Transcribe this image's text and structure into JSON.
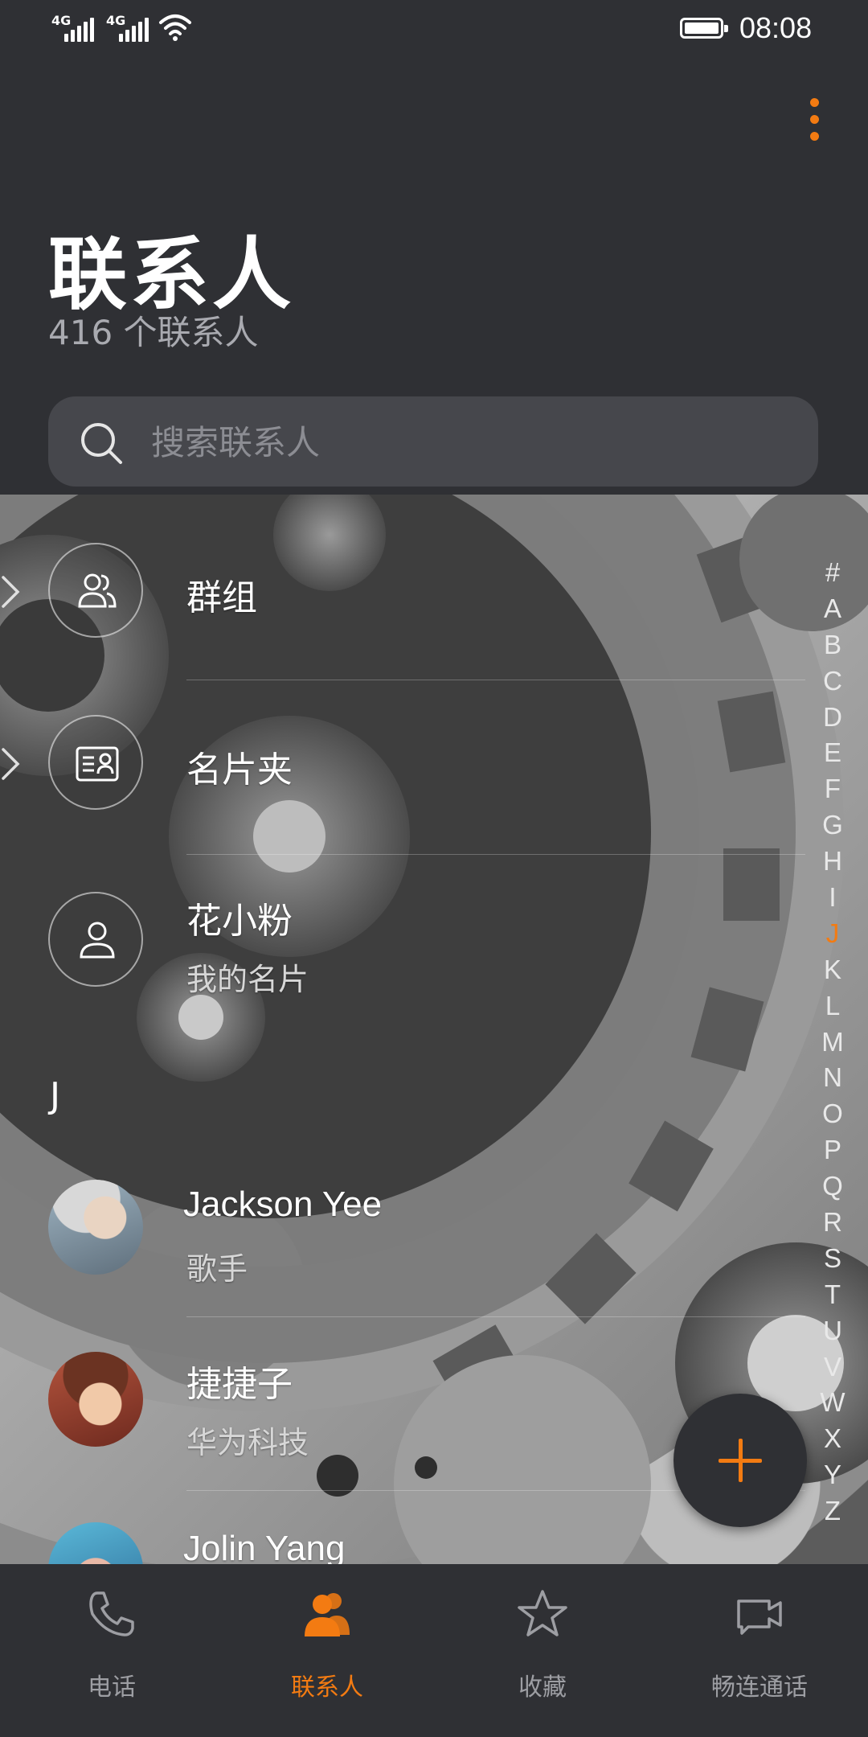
{
  "status_bar": {
    "network_1": "4G",
    "network_2": "4G",
    "time": "08:08"
  },
  "header": {
    "title": "联系人",
    "subtitle": "416 个联系人",
    "more_icon": "more-vertical-icon"
  },
  "search": {
    "placeholder": "搜索联系人"
  },
  "list": {
    "groups": {
      "label": "群组",
      "icon": "group-icon"
    },
    "cards": {
      "label": "名片夹",
      "icon": "business-card-icon"
    },
    "me": {
      "name": "花小粉",
      "subtitle": "我的名片",
      "icon": "person-icon"
    },
    "section_letter": "J",
    "contacts": [
      {
        "name": "Jackson Yee",
        "subtitle": "歌手"
      },
      {
        "name": "捷捷子",
        "subtitle": "华为科技"
      },
      {
        "name": "Jolin Yang",
        "subtitle": ""
      }
    ]
  },
  "alphabet_index": [
    "#",
    "A",
    "B",
    "C",
    "D",
    "E",
    "F",
    "G",
    "H",
    "I",
    "J",
    "K",
    "L",
    "M",
    "N",
    "O",
    "P",
    "Q",
    "R",
    "S",
    "T",
    "U",
    "V",
    "W",
    "X",
    "Y",
    "Z"
  ],
  "alphabet_active": "J",
  "bottom_nav": [
    {
      "label": "电话",
      "icon": "phone-icon",
      "active": false
    },
    {
      "label": "联系人",
      "icon": "contacts-icon",
      "active": true
    },
    {
      "label": "收藏",
      "icon": "star-icon",
      "active": false
    },
    {
      "label": "畅连通话",
      "icon": "video-call-icon",
      "active": false
    }
  ],
  "colors": {
    "accent": "#f37b12",
    "background": "#2f3034",
    "search_bg": "#46474c"
  }
}
